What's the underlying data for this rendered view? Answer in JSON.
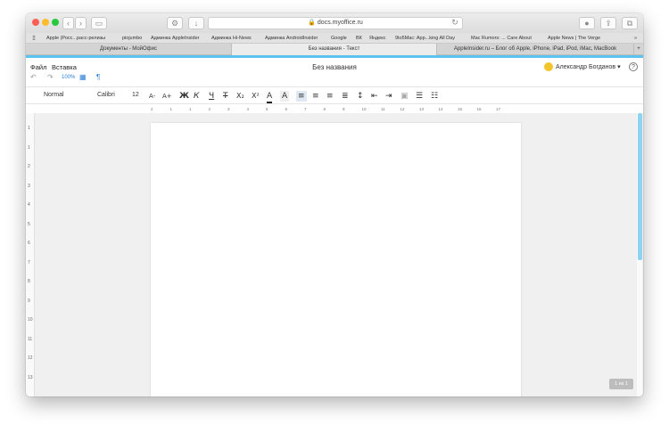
{
  "browser": {
    "url": "docs.myoffice.ru",
    "bookmarks": [
      "Apple (Росс...расс-релизы",
      "piojumbo",
      "Админка AppleInsider",
      "Админка Hi-News",
      "Админка AndroidInsider",
      "Google",
      "ВК",
      "Яндекс",
      "9to5Mac: App...king All Day",
      "Mac Rumors: ... Care About",
      "Apple News | The Verge"
    ],
    "tabs": [
      "Документы - МойОфис",
      "Без названия - Текст",
      "AppleInsider.ru – Блог об Apple, iPhone, iPad, iPod, iMac, MacBook"
    ]
  },
  "app": {
    "menu": {
      "file": "Файл",
      "insert": "Вставка"
    },
    "zoom": "100%",
    "doc_title": "Без названия",
    "user_name": "Александр Богданов",
    "help": "?"
  },
  "toolbar": {
    "style": "Normal",
    "font": "Calibri",
    "size": "12",
    "buttons": {
      "smaller": "A-",
      "larger": "A+",
      "bold": "Ж",
      "italic": "К",
      "underline": "Ч",
      "strike": "Т",
      "sub": "X₂",
      "sup": "X²",
      "color": "A",
      "highlight": "A"
    }
  },
  "ruler": {
    "h": [
      "2",
      "1",
      "1",
      "2",
      "3",
      "4",
      "5",
      "6",
      "7",
      "8",
      "9",
      "10",
      "11",
      "12",
      "13",
      "14",
      "15",
      "16",
      "17"
    ],
    "v": [
      "1",
      "1",
      "2",
      "3",
      "4",
      "5",
      "6",
      "7",
      "8",
      "9",
      "10",
      "11",
      "12",
      "13"
    ]
  },
  "page_indicator": "1 из 1",
  "colors": {
    "accent": "#5cc2ef",
    "avatar": "#f3c42b"
  }
}
